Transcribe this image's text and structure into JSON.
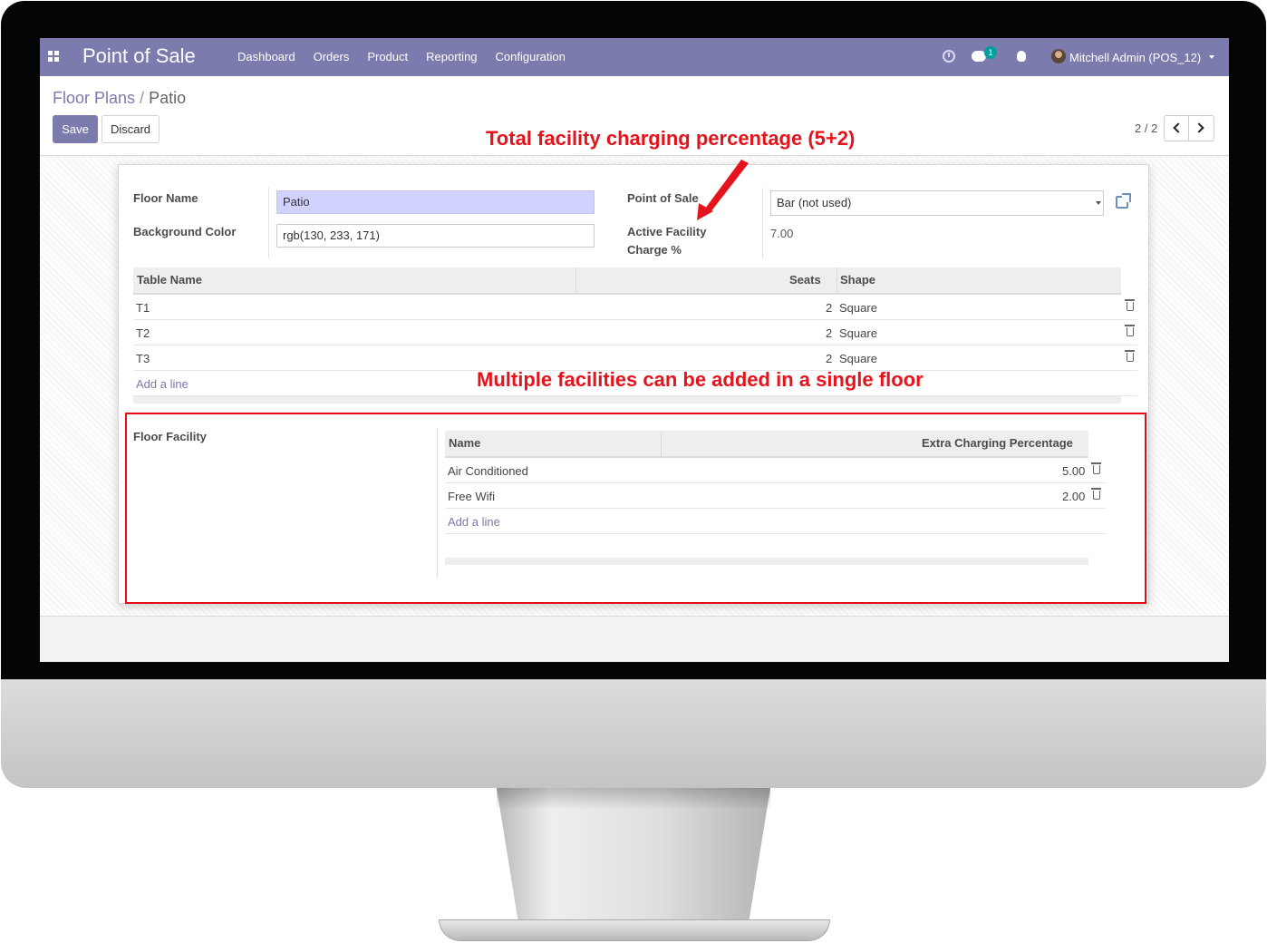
{
  "navbar": {
    "brand": "Point of Sale",
    "menu": [
      "Dashboard",
      "Orders",
      "Product",
      "Reporting",
      "Configuration"
    ],
    "chat_count": "1",
    "user": "Mitchell Admin (POS_12)"
  },
  "breadcrumb": {
    "parent": "Floor Plans",
    "current": "Patio"
  },
  "buttons": {
    "save": "Save",
    "discard": "Discard"
  },
  "pager": {
    "value": "2 / 2"
  },
  "form": {
    "floor_name_label": "Floor Name",
    "floor_name_value": "Patio",
    "bg_color_label": "Background Color",
    "bg_color_value": "rgb(130, 233, 171)",
    "pos_label": "Point of Sale",
    "pos_value": "Bar (not used)",
    "charge_label_1": "Active Facility",
    "charge_label_2": "Charge %",
    "charge_value": "7.00"
  },
  "tables_list": {
    "headers": {
      "name": "Table Name",
      "seats": "Seats",
      "shape": "Shape"
    },
    "rows": [
      {
        "name": "T1",
        "seats": "2",
        "shape": "Square"
      },
      {
        "name": "T2",
        "seats": "2",
        "shape": "Square"
      },
      {
        "name": "T3",
        "seats": "2",
        "shape": "Square"
      }
    ],
    "add_line": "Add a line"
  },
  "facility": {
    "label": "Floor Facility",
    "headers": {
      "name": "Name",
      "extra": "Extra Charging Percentage"
    },
    "rows": [
      {
        "name": "Air Conditioned",
        "extra": "5.00"
      },
      {
        "name": "Free Wifi",
        "extra": "2.00"
      }
    ],
    "add_line": "Add a line"
  },
  "annotations": {
    "top": "Total facility charging percentage (5+2)",
    "middle": "Multiple facilities can be added in a single floor"
  },
  "colors": {
    "navbar": "#7c7bad",
    "annotation": "#e5141c",
    "required_field": "#d2d2ff"
  }
}
